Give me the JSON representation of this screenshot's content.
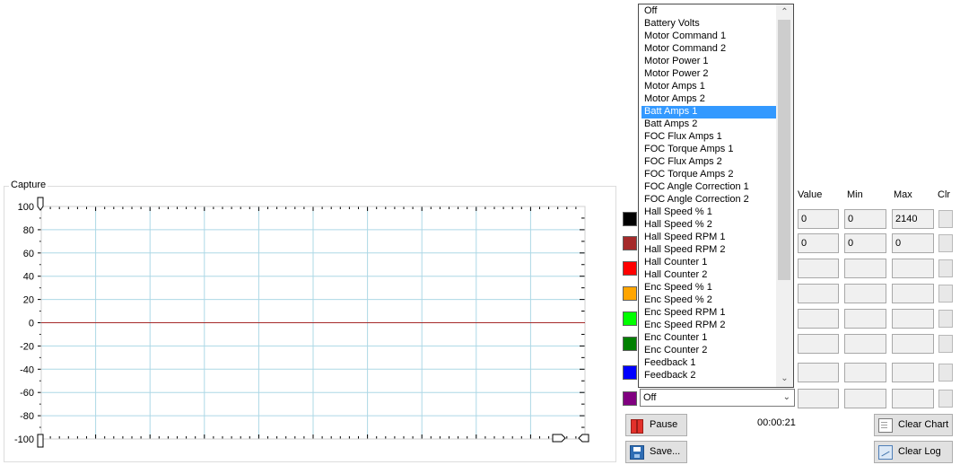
{
  "capture": {
    "title": "Capture"
  },
  "chart_data": {
    "type": "line",
    "title": "",
    "xlabel": "",
    "ylabel": "",
    "ylim": [
      -100,
      100
    ],
    "yticks": [
      "100",
      "80",
      "60",
      "40",
      "20",
      "0",
      "-20",
      "-40",
      "-60",
      "-80",
      "-100"
    ],
    "grid": true,
    "series": [
      {
        "values": [
          0,
          0
        ],
        "color": "#a52a2a"
      }
    ]
  },
  "headers": {
    "value": "Value",
    "min": "Min",
    "max": "Max",
    "clr": "Clr"
  },
  "channels": [
    {
      "color": "#000000",
      "value": "0",
      "min": "0",
      "max": "2140"
    },
    {
      "color": "#a52a2a",
      "value": "0",
      "min": "0",
      "max": "0"
    },
    {
      "color": "#ff0000",
      "value": "",
      "min": "",
      "max": ""
    },
    {
      "color": "#ffa500",
      "value": "",
      "min": "",
      "max": ""
    },
    {
      "color": "#00ff00",
      "value": "",
      "min": "",
      "max": ""
    },
    {
      "color": "#008000",
      "value": "",
      "min": "",
      "max": ""
    },
    {
      "color": "#0000ff",
      "value": "",
      "min": "",
      "max": ""
    },
    {
      "color": "#800080",
      "value": "",
      "min": "",
      "max": ""
    }
  ],
  "combo": {
    "selected": "Off"
  },
  "dropdown": {
    "selected_index": 8,
    "options": [
      "Off",
      "Battery Volts",
      "Motor Command 1",
      "Motor Command 2",
      "Motor Power 1",
      "Motor Power 2",
      "Motor Amps 1",
      "Motor Amps 2",
      "Batt Amps 1",
      "Batt Amps 2",
      "FOC Flux Amps 1",
      "FOC Torque Amps 1",
      "FOC Flux Amps 2",
      "FOC Torque Amps 2",
      "FOC Angle Correction 1",
      "FOC Angle Correction 2",
      "Hall Speed % 1",
      "Hall Speed % 2",
      "Hall Speed RPM 1",
      "Hall Speed RPM 2",
      "Hall Counter 1",
      "Hall Counter 2",
      "Enc Speed % 1",
      "Enc Speed % 2",
      "Enc Speed RPM 1",
      "Enc Speed RPM 2",
      "Enc Counter 1",
      "Enc Counter 2",
      "Feedback 1",
      "Feedback 2"
    ]
  },
  "buttons": {
    "pause": "Pause",
    "save": "Save...",
    "clear_chart": "Clear Chart",
    "clear_log": "Clear Log"
  },
  "timer": "00:00:21"
}
